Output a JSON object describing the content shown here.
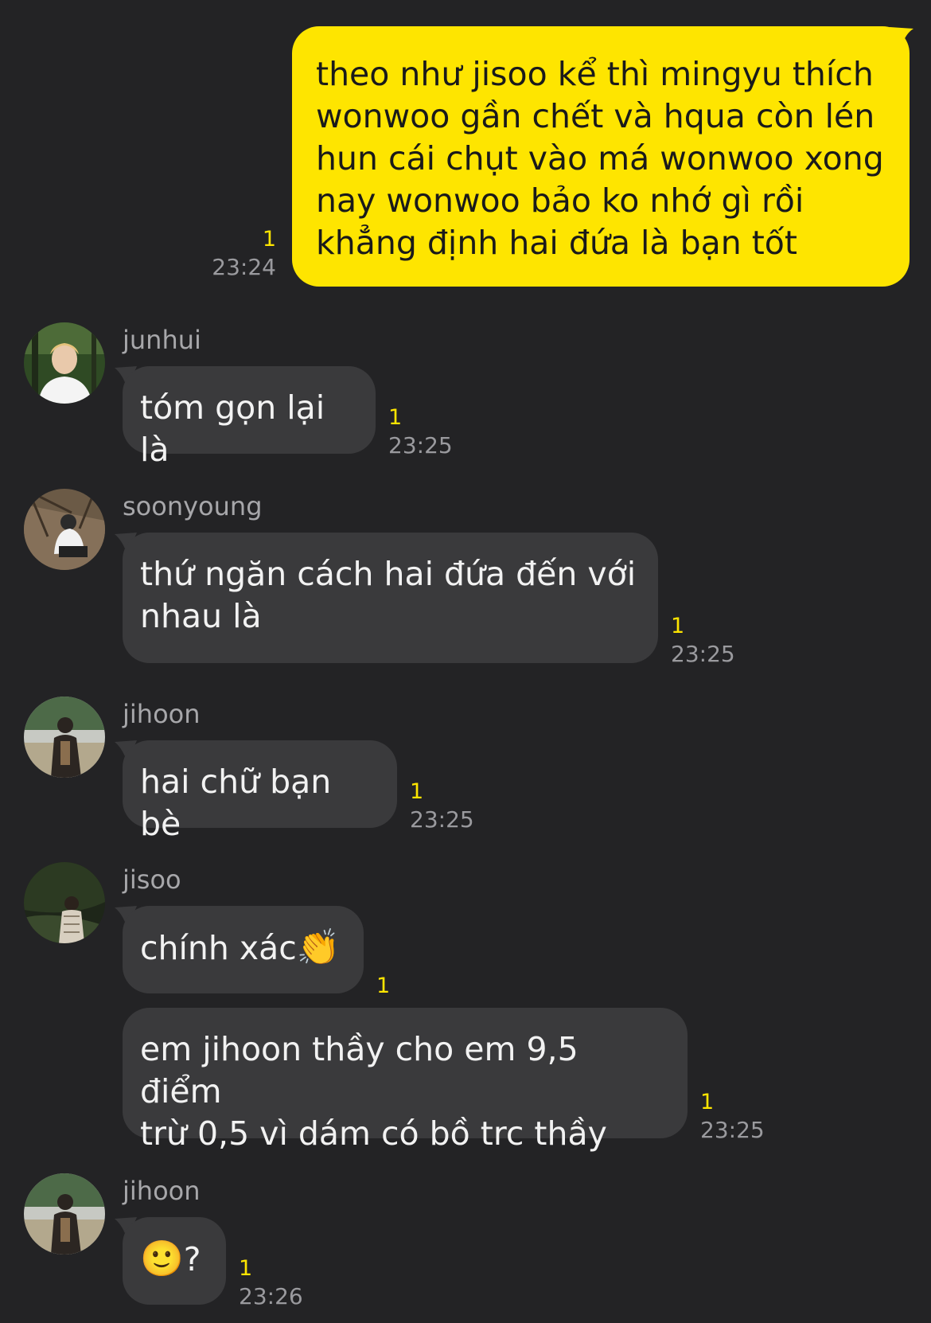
{
  "colors": {
    "background": "#232325",
    "outgoing_bubble": "#fee500",
    "incoming_bubble": "#3a3a3c",
    "unread_count": "#fee500",
    "timestamp": "#9a9a9e"
  },
  "messages": [
    {
      "direction": "outgoing",
      "text": "theo như jisoo kể thì mingyu thích\nwonwoo gần chết và hqua còn lén\nhun cái chụt vào má wonwoo xong\nnay wonwoo bảo ko nhớ gì rồi\nkhẳng định hai đứa là bạn tốt",
      "unread": "1",
      "time": "23:24"
    },
    {
      "direction": "incoming",
      "sender": "junhui",
      "avatar_icon": "profile-photo",
      "text": "tóm gọn lại là",
      "unread": "1",
      "time": "23:25"
    },
    {
      "direction": "incoming",
      "sender": "soonyoung",
      "avatar_icon": "profile-photo",
      "text": "thứ ngăn cách hai đứa đến với\nnhau là",
      "unread": "1",
      "time": "23:25"
    },
    {
      "direction": "incoming",
      "sender": "jihoon",
      "avatar_icon": "profile-photo",
      "text": "hai chữ bạn bè",
      "unread": "1",
      "time": "23:25"
    },
    {
      "direction": "incoming",
      "sender": "jisoo",
      "avatar_icon": "profile-photo",
      "text": "chính xác",
      "emoji": "👏",
      "unread": "1",
      "time": ""
    },
    {
      "direction": "incoming",
      "sender": "",
      "text": "em jihoon thầy cho em 9,5 điểm\ntrừ 0,5 vì dám có bồ trc thầy",
      "unread": "1",
      "time": "23:25"
    },
    {
      "direction": "incoming",
      "sender": "jihoon",
      "avatar_icon": "profile-photo",
      "text": "?",
      "emoji": "🙂",
      "unread": "1",
      "time": "23:26"
    }
  ]
}
